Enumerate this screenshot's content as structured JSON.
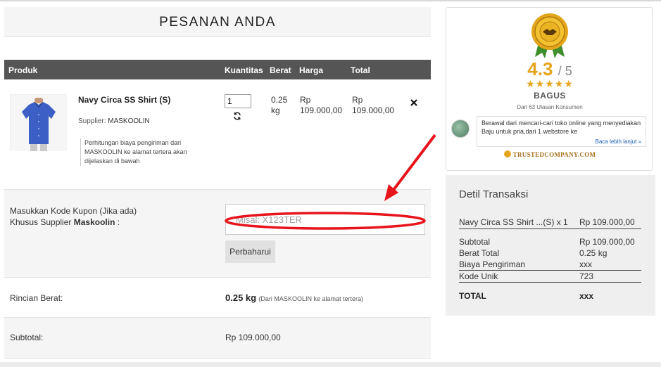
{
  "order": {
    "title": "PESANAN ANDA",
    "columns": [
      "Produk",
      "Kuantitas",
      "Berat",
      "Harga",
      "Total"
    ],
    "item": {
      "name": "Navy Circa SS Shirt (S)",
      "supplier_label": "Supplier:",
      "supplier_name": "MASKOOLIN",
      "note": "Perhitungan biaya pengiriman dari MASKOOLIN ke alamat tertera akan dijelaskan di bawah",
      "quantity": "1",
      "weight": "0.25 kg",
      "price": "Rp 109.000,00",
      "total": "Rp 109.000,00"
    },
    "coupon": {
      "label_line1": "Masukkan Kode Kupon (Jika ada)",
      "label_line2_prefix": "Khusus Supplier",
      "label_supplier": "Maskoolin",
      "label_suffix": ":",
      "placeholder": "Misal: X123TER",
      "update_label": "Perbaharui"
    },
    "weight_row": {
      "label": "Rincian Berat:",
      "value": "0.25 kg",
      "note": "(Dari MASKOOLIN ke alamat tertera)"
    },
    "subtotal_row": {
      "label": "Subtotal:",
      "value": "Rp 109.000,00"
    }
  },
  "trusted": {
    "score": "4.3",
    "score_max": "/ 5",
    "stars": "★★★★★",
    "rating": 4.3,
    "rating_word": "BAGUS",
    "review_count": "Dari 63 Ulasan Konsumen",
    "review_text": "Berawal dari mencari-cari toko online yang menyediakan Baju untuk pria,dari 1 webstore ke",
    "read_more": "Baca lebih lanjut »",
    "brand": "TRUSTEDCOMPANY.COM"
  },
  "transaction": {
    "title": "Detil Transaksi",
    "item_label": "Navy Circa SS Shirt ...(S) x 1",
    "item_value": "Rp 109.000,00",
    "rows": [
      {
        "label": "Subtotal",
        "value": "Rp 109.000,00"
      },
      {
        "label": "Berat Total",
        "value": "0.25 kg"
      },
      {
        "label": "Biaya Pengiriman",
        "value": "xxx"
      },
      {
        "label": "Kode Unik",
        "value": "723"
      }
    ],
    "total_label": "TOTAL",
    "total_value": "xxx"
  },
  "colors": {
    "table_header": "#555555",
    "annotation": "#e8141c",
    "accent_gold": "#e6a520"
  }
}
